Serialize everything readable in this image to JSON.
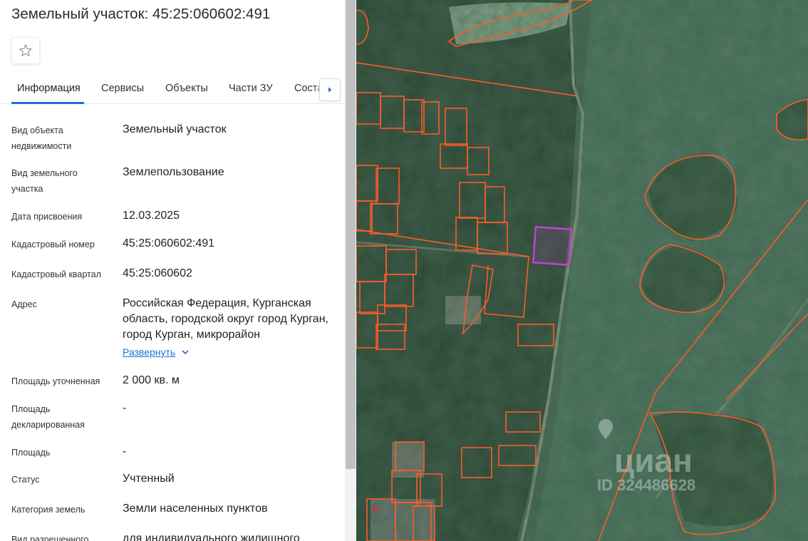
{
  "title": "Земельный участок: 45:25:060602:491",
  "favorite_icon": "star-outline-icon",
  "tabs": [
    {
      "label": "Информация",
      "active": true
    },
    {
      "label": "Сервисы",
      "active": false
    },
    {
      "label": "Объекты",
      "active": false
    },
    {
      "label": "Части ЗУ",
      "active": false
    },
    {
      "label": "Соста",
      "active": false
    }
  ],
  "tabs_scroll_icon": "chevron-right-icon",
  "fields": {
    "object_type": {
      "label": "Вид объекта недвижимости",
      "value": "Земельный участок"
    },
    "land_type": {
      "label": "Вид земельного участка",
      "value": "Землепользование"
    },
    "assigned_date": {
      "label": "Дата присвоения",
      "value": "12.03.2025"
    },
    "cadastral_number": {
      "label": "Кадастровый номер",
      "value": "45:25:060602:491"
    },
    "cadastral_quarter": {
      "label": "Кадастровый квартал",
      "value": "45:25:060602"
    },
    "address": {
      "label": "Адрес",
      "value": "Российская Федерация, Курганская область, городской округ город Курган, город Курган, микрорайон"
    },
    "area_precise": {
      "label": "Площадь уточненная",
      "value": "2 000 кв. м"
    },
    "area_declared": {
      "label": "Площадь декларированная",
      "value": "-"
    },
    "area": {
      "label": "Площадь",
      "value": "-"
    },
    "status": {
      "label": "Статус",
      "value": "Учтенный"
    },
    "land_category": {
      "label": "Категория земель",
      "value": "Земли населенных пунктов"
    },
    "permitted_use": {
      "label": "Вид разрешенного",
      "value": "для индивидуального жилищного"
    }
  },
  "expand_label": "Развернуть",
  "expand_icon": "chevron-down-icon",
  "watermark": {
    "brand": "циан",
    "id_text": "ID 324486628"
  },
  "colors": {
    "accent": "#1f6fd6",
    "parcel_outline": "#ff5a2a",
    "selected_parcel": "#c63fd0"
  }
}
